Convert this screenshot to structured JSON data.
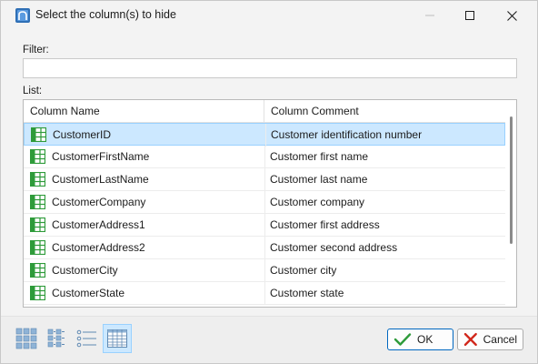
{
  "window": {
    "title": "Select the column(s) to hide"
  },
  "filter": {
    "label": "Filter:",
    "value": "",
    "placeholder": ""
  },
  "list": {
    "label": "List:",
    "columns": [
      "Column Name",
      "Column Comment"
    ],
    "rows": [
      {
        "name": "CustomerID",
        "comment": "Customer identification number",
        "selected": true
      },
      {
        "name": "CustomerFirstName",
        "comment": "Customer first name",
        "selected": false
      },
      {
        "name": "CustomerLastName",
        "comment": "Customer last name",
        "selected": false
      },
      {
        "name": "CustomerCompany",
        "comment": "Customer company",
        "selected": false
      },
      {
        "name": "CustomerAddress1",
        "comment": "Customer first address",
        "selected": false
      },
      {
        "name": "CustomerAddress2",
        "comment": "Customer second address",
        "selected": false
      },
      {
        "name": "CustomerCity",
        "comment": "Customer city",
        "selected": false
      },
      {
        "name": "CustomerState",
        "comment": "Customer state",
        "selected": false
      }
    ],
    "row_icon": "table-column-icon"
  },
  "footer": {
    "view_modes": [
      {
        "icon": "large-icons-view-icon",
        "active": false
      },
      {
        "icon": "small-icons-view-icon",
        "active": false
      },
      {
        "icon": "list-view-icon",
        "active": false
      },
      {
        "icon": "details-view-icon",
        "active": true
      }
    ],
    "ok_label": "OK",
    "cancel_label": "Cancel"
  },
  "colors": {
    "selection_bg": "#cce8ff",
    "selection_border": "#99d1ff",
    "column_icon_green": "#2e9b3a",
    "ok_check_green": "#2e9b3a",
    "cancel_x_red": "#d1271b"
  }
}
